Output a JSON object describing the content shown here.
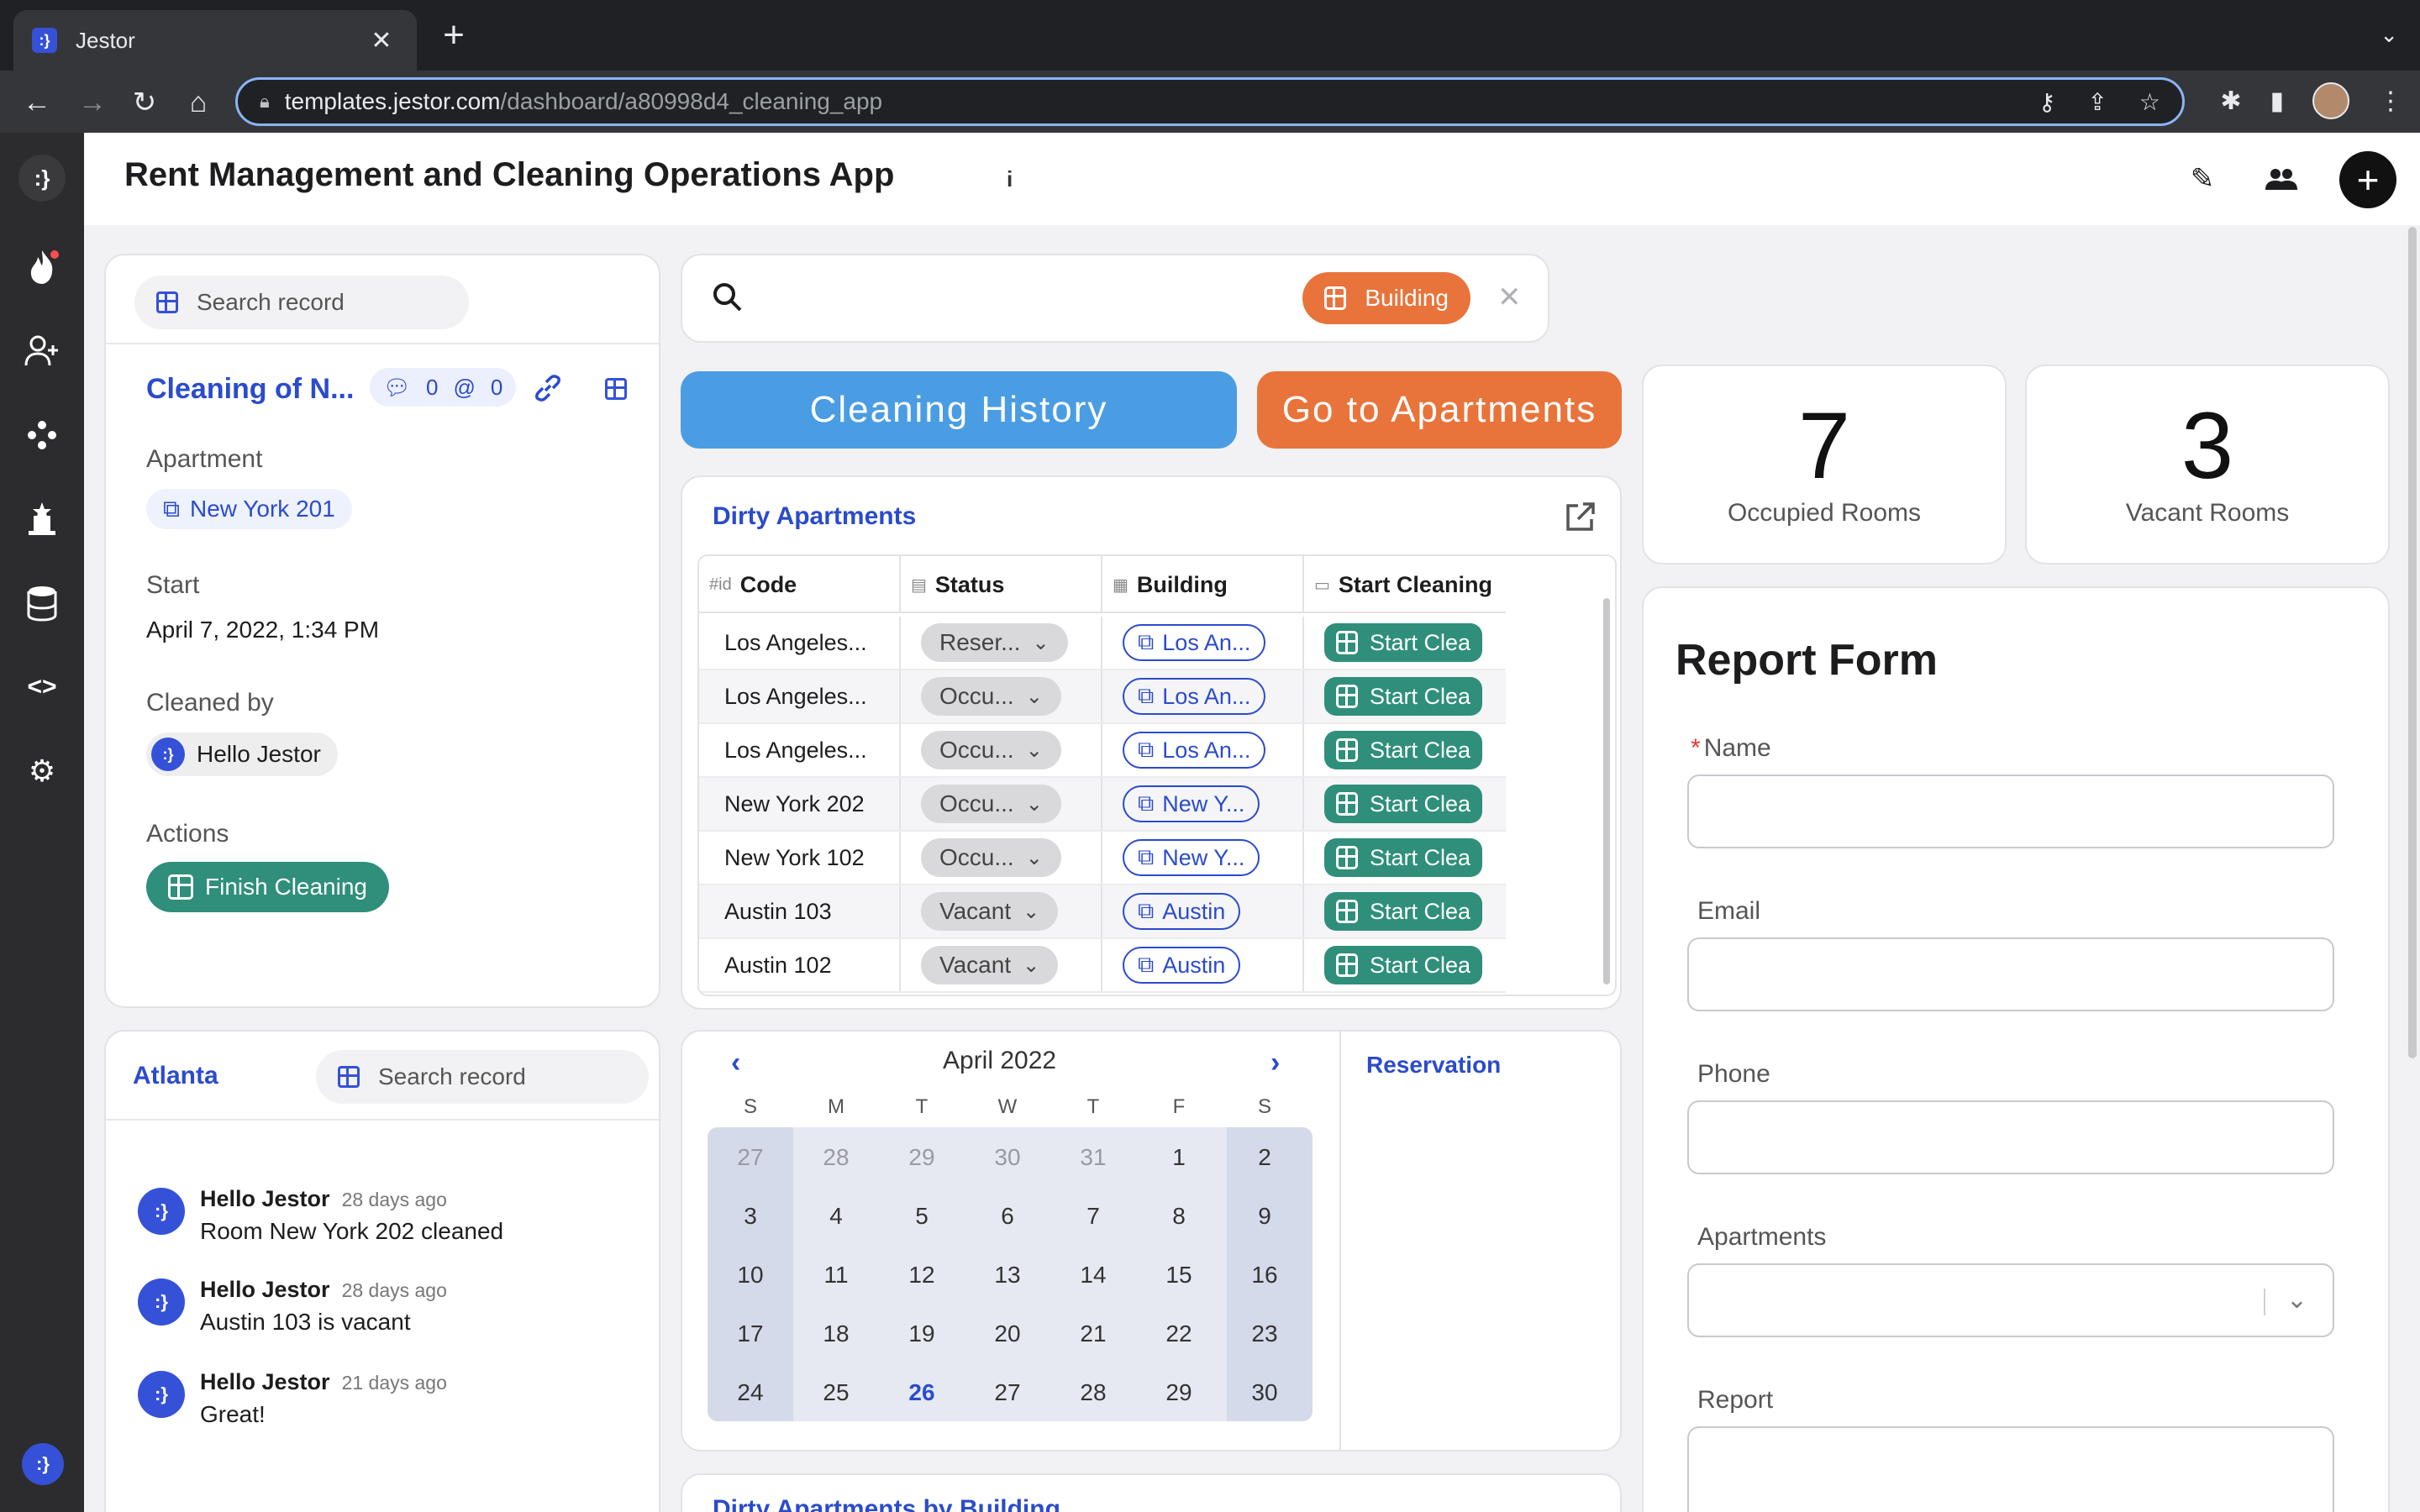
{
  "browser": {
    "tab_title": "Jestor",
    "tab_favicon": ":}",
    "url_host": "templates.jestor.com",
    "url_path": "/dashboard/a80998d4_cleaning_app"
  },
  "app": {
    "title": "Rent Management and Cleaning Operations App",
    "logo": ":}",
    "accent": "#2b4bcc"
  },
  "record_card": {
    "search_placeholder": "Search record",
    "title": "Cleaning of N...",
    "comment_count": "0",
    "mention_count": "0",
    "fields": {
      "apartment_label": "Apartment",
      "apartment_value": "New York 201",
      "start_label": "Start",
      "start_value": "April 7, 2022, 1:34 PM",
      "cleaned_by_label": "Cleaned by",
      "cleaned_by_value": "Hello Jestor",
      "actions_label": "Actions",
      "finish_label": "Finish Cleaning"
    }
  },
  "search_bar": {
    "filter_label": "Building"
  },
  "buttons": {
    "cleaning_history": "Cleaning History",
    "go_to_apartments": "Go to Apartments"
  },
  "stats": {
    "occupied_value": "7",
    "occupied_label": "Occupied Rooms",
    "vacant_value": "3",
    "vacant_label": "Vacant Rooms"
  },
  "dirty_apartments": {
    "title": "Dirty Apartments",
    "columns": {
      "code_icon": "#id",
      "code": "Code",
      "status": "Status",
      "building": "Building",
      "start": "Start Cleaning"
    },
    "rows": [
      {
        "code": "Los Angeles...",
        "status": "Reser...",
        "building": "Los An...",
        "action": "Start Clea"
      },
      {
        "code": "Los Angeles...",
        "status": "Occu...",
        "building": "Los An...",
        "action": "Start Clea"
      },
      {
        "code": "Los Angeles...",
        "status": "Occu...",
        "building": "Los An...",
        "action": "Start Clea"
      },
      {
        "code": "New York 202",
        "status": "Occu...",
        "building": "New Y...",
        "action": "Start Clea"
      },
      {
        "code": "New York 102",
        "status": "Occu...",
        "building": "New Y...",
        "action": "Start Clea"
      },
      {
        "code": "Austin 103",
        "status": "Vacant",
        "building": "Austin",
        "action": "Start Clea"
      },
      {
        "code": "Austin 102",
        "status": "Vacant",
        "building": "Austin",
        "action": "Start Clea"
      }
    ]
  },
  "calendar": {
    "month": "April 2022",
    "dow": [
      "S",
      "M",
      "T",
      "W",
      "T",
      "F",
      "S"
    ],
    "weeks": [
      [
        "27",
        "28",
        "29",
        "30",
        "31",
        "1",
        "2"
      ],
      [
        "3",
        "4",
        "5",
        "6",
        "7",
        "8",
        "9"
      ],
      [
        "10",
        "11",
        "12",
        "13",
        "14",
        "15",
        "16"
      ],
      [
        "17",
        "18",
        "19",
        "20",
        "21",
        "22",
        "23"
      ],
      [
        "24",
        "25",
        "26",
        "27",
        "28",
        "29",
        "30"
      ]
    ],
    "today": "26",
    "side_title": "Reservation"
  },
  "atlanta": {
    "title": "Atlanta",
    "search_placeholder": "Search record",
    "comments": [
      {
        "author": "Hello Jestor",
        "time": "28 days ago",
        "text": "Room New York 202 cleaned"
      },
      {
        "author": "Hello Jestor",
        "time": "28 days ago",
        "text": "Austin 103 is vacant"
      },
      {
        "author": "Hello Jestor",
        "time": "21 days ago",
        "text": "Great!"
      }
    ]
  },
  "report_form": {
    "title": "Report Form",
    "name_label": "Name",
    "email_label": "Email",
    "phone_label": "Phone",
    "apartments_label": "Apartments",
    "report_label": "Report"
  },
  "bottom_section": {
    "title": "Dirty Apartments by Building"
  }
}
